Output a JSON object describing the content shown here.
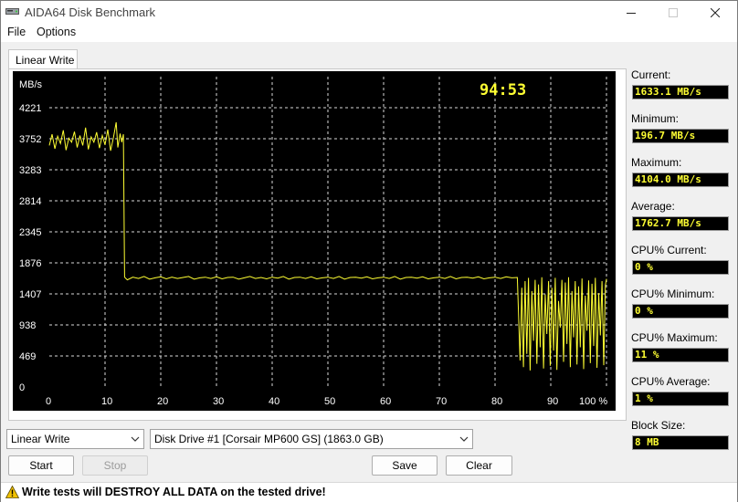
{
  "window": {
    "title": "AIDA64 Disk Benchmark"
  },
  "menu": [
    "File",
    "Options"
  ],
  "tab": {
    "label": "Linear Write"
  },
  "chart_data": {
    "type": "line",
    "timer": "94:53",
    "ylabel": "MB/s",
    "ylim": [
      0,
      4690
    ],
    "y_ticks": [
      0,
      469,
      938,
      1407,
      1876,
      2345,
      2814,
      3283,
      3752,
      4221
    ],
    "x_ticks": [
      "0",
      "10",
      "20",
      "30",
      "40",
      "50",
      "60",
      "70",
      "80",
      "90",
      "100 %"
    ],
    "xlim": [
      0,
      100
    ],
    "grid": true,
    "line_color": "#ffff33",
    "background": "#000000",
    "series": [
      {
        "points": [
          [
            0,
            3650
          ],
          [
            0.5,
            3820
          ],
          [
            1,
            3600
          ],
          [
            1.5,
            3790
          ],
          [
            2,
            3680
          ],
          [
            2.5,
            3880
          ],
          [
            3,
            3580
          ],
          [
            3.5,
            3760
          ],
          [
            4,
            3700
          ],
          [
            4.5,
            3860
          ],
          [
            5,
            3620
          ],
          [
            5.5,
            3800
          ],
          [
            6,
            3650
          ],
          [
            6.5,
            3920
          ],
          [
            7,
            3590
          ],
          [
            7.5,
            3780
          ],
          [
            8,
            3700
          ],
          [
            8.5,
            3850
          ],
          [
            9,
            3610
          ],
          [
            9.5,
            3800
          ],
          [
            10,
            3660
          ],
          [
            10.5,
            3890
          ],
          [
            11,
            3570
          ],
          [
            11.5,
            3770
          ],
          [
            12,
            4000
          ],
          [
            12.3,
            3620
          ],
          [
            12.7,
            3830
          ],
          [
            13,
            3700
          ],
          [
            13.3,
            3820
          ],
          [
            13.5,
            1660
          ],
          [
            14,
            1620
          ],
          [
            15,
            1660
          ],
          [
            16,
            1640
          ],
          [
            17,
            1670
          ],
          [
            18,
            1630
          ],
          [
            19,
            1650
          ],
          [
            20,
            1665
          ],
          [
            21,
            1635
          ],
          [
            22,
            1660
          ],
          [
            23,
            1640
          ],
          [
            24,
            1655
          ],
          [
            25,
            1670
          ],
          [
            26,
            1630
          ],
          [
            27,
            1650
          ],
          [
            28,
            1660
          ],
          [
            29,
            1640
          ],
          [
            30,
            1665
          ],
          [
            31,
            1635
          ],
          [
            32,
            1655
          ],
          [
            33,
            1660
          ],
          [
            34,
            1630
          ],
          [
            35,
            1650
          ],
          [
            36,
            1670
          ],
          [
            37,
            1640
          ],
          [
            38,
            1655
          ],
          [
            39,
            1635
          ],
          [
            40,
            1660
          ],
          [
            41,
            1645
          ],
          [
            42,
            1670
          ],
          [
            43,
            1630
          ],
          [
            44,
            1655
          ],
          [
            45,
            1660
          ],
          [
            46,
            1640
          ],
          [
            47,
            1665
          ],
          [
            48,
            1635
          ],
          [
            49,
            1650
          ],
          [
            50,
            1660
          ],
          [
            51,
            1640
          ],
          [
            52,
            1670
          ],
          [
            53,
            1630
          ],
          [
            54,
            1655
          ],
          [
            55,
            1660
          ],
          [
            56,
            1645
          ],
          [
            57,
            1665
          ],
          [
            58,
            1635
          ],
          [
            59,
            1650
          ],
          [
            60,
            1660
          ],
          [
            61,
            1640
          ],
          [
            62,
            1670
          ],
          [
            63,
            1630
          ],
          [
            64,
            1655
          ],
          [
            65,
            1660
          ],
          [
            66,
            1645
          ],
          [
            67,
            1665
          ],
          [
            68,
            1635
          ],
          [
            69,
            1650
          ],
          [
            70,
            1660
          ],
          [
            71,
            1640
          ],
          [
            72,
            1670
          ],
          [
            73,
            1635
          ],
          [
            74,
            1655
          ],
          [
            75,
            1660
          ],
          [
            76,
            1645
          ],
          [
            77,
            1665
          ],
          [
            78,
            1635
          ],
          [
            79,
            1650
          ],
          [
            80,
            1660
          ],
          [
            81,
            1640
          ],
          [
            82,
            1665
          ],
          [
            83,
            1650
          ],
          [
            84,
            1655
          ],
          [
            84.5,
            400
          ],
          [
            84.8,
            1500
          ],
          [
            85.1,
            300
          ],
          [
            85.4,
            1600
          ],
          [
            85.7,
            500
          ],
          [
            86,
            1650
          ],
          [
            86.3,
            250
          ],
          [
            86.6,
            1450
          ],
          [
            86.9,
            700
          ],
          [
            87.2,
            1620
          ],
          [
            87.5,
            350
          ],
          [
            87.8,
            1550
          ],
          [
            88.1,
            600
          ],
          [
            88.4,
            1660
          ],
          [
            88.7,
            280
          ],
          [
            89,
            1400
          ],
          [
            89.3,
            800
          ],
          [
            89.6,
            1600
          ],
          [
            89.9,
            320
          ],
          [
            90.2,
            1500
          ],
          [
            90.5,
            550
          ],
          [
            90.8,
            1650
          ],
          [
            91.1,
            260
          ],
          [
            91.4,
            1300
          ],
          [
            91.7,
            900
          ],
          [
            92,
            1620
          ],
          [
            92.3,
            380
          ],
          [
            92.6,
            1580
          ],
          [
            92.9,
            650
          ],
          [
            93.2,
            1660
          ],
          [
            93.5,
            300
          ],
          [
            93.8,
            1450
          ],
          [
            94.1,
            750
          ],
          [
            94.4,
            1600
          ],
          [
            94.7,
            340
          ],
          [
            95,
            1520
          ],
          [
            95.3,
            600
          ],
          [
            95.6,
            1640
          ],
          [
            95.9,
            270
          ],
          [
            96.2,
            1380
          ],
          [
            96.5,
            850
          ],
          [
            96.8,
            1610
          ],
          [
            97.1,
            360
          ],
          [
            97.4,
            1560
          ],
          [
            97.7,
            620
          ],
          [
            98,
            1650
          ],
          [
            98.3,
            290
          ],
          [
            98.6,
            1420
          ],
          [
            98.9,
            780
          ],
          [
            99.2,
            1600
          ],
          [
            99.5,
            330
          ],
          [
            99.8,
            1540
          ],
          [
            100,
            1633
          ]
        ]
      }
    ]
  },
  "stats": [
    {
      "label": "Current:",
      "value": "1633.1 MB/s"
    },
    {
      "label": "Minimum:",
      "value": "196.7 MB/s"
    },
    {
      "label": "Maximum:",
      "value": "4104.0 MB/s"
    },
    {
      "label": "Average:",
      "value": "1762.7 MB/s"
    },
    {
      "label": "CPU% Current:",
      "value": "0 %"
    },
    {
      "label": "CPU% Minimum:",
      "value": "0 %"
    },
    {
      "label": "CPU% Maximum:",
      "value": "11 %"
    },
    {
      "label": "CPU% Average:",
      "value": "1 %"
    },
    {
      "label": "Block Size:",
      "value": "8 MB"
    }
  ],
  "controls": {
    "test_select": "Linear Write",
    "drive_select": "Disk Drive #1  [Corsair MP600 GS]  (1863.0 GB)",
    "start": "Start",
    "stop": "Stop",
    "save": "Save",
    "clear": "Clear"
  },
  "warning": "Write tests will DESTROY ALL DATA on the tested drive!"
}
